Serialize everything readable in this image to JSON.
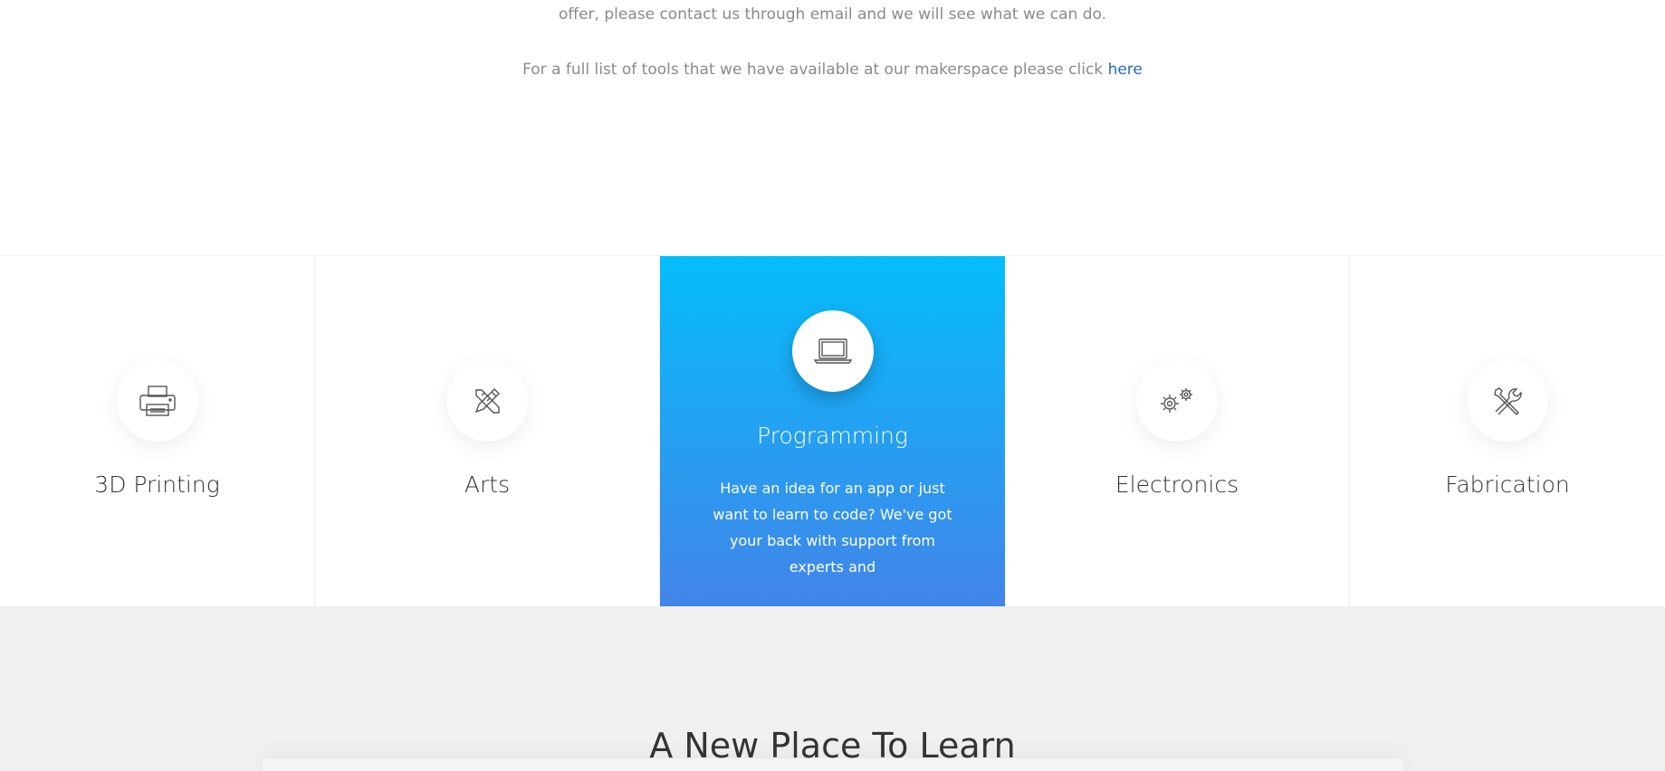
{
  "intro": {
    "line1": "offer, please contact us through email and we will see what we can do.",
    "line2_text": "For a full list of tools that we have available at our makerspace please click ",
    "line2_link": "here"
  },
  "services": [
    {
      "title": "3D Printing",
      "icon": "printer-icon"
    },
    {
      "title": "Arts",
      "icon": "pencil-ruler-icon"
    },
    {
      "title": "Programming",
      "icon": "laptop-icon",
      "description": "Have an idea for an app or just want to learn to code? We've got your back with support from experts and"
    },
    {
      "title": "Electronics",
      "icon": "gears-icon"
    },
    {
      "title": "Fabrication",
      "icon": "tools-icon"
    }
  ],
  "learn": {
    "heading": "A New Place To Learn"
  },
  "colors": {
    "gradient_top": "#05bdfb",
    "gradient_bottom": "#4384e8",
    "link": "#2a6bb8"
  }
}
